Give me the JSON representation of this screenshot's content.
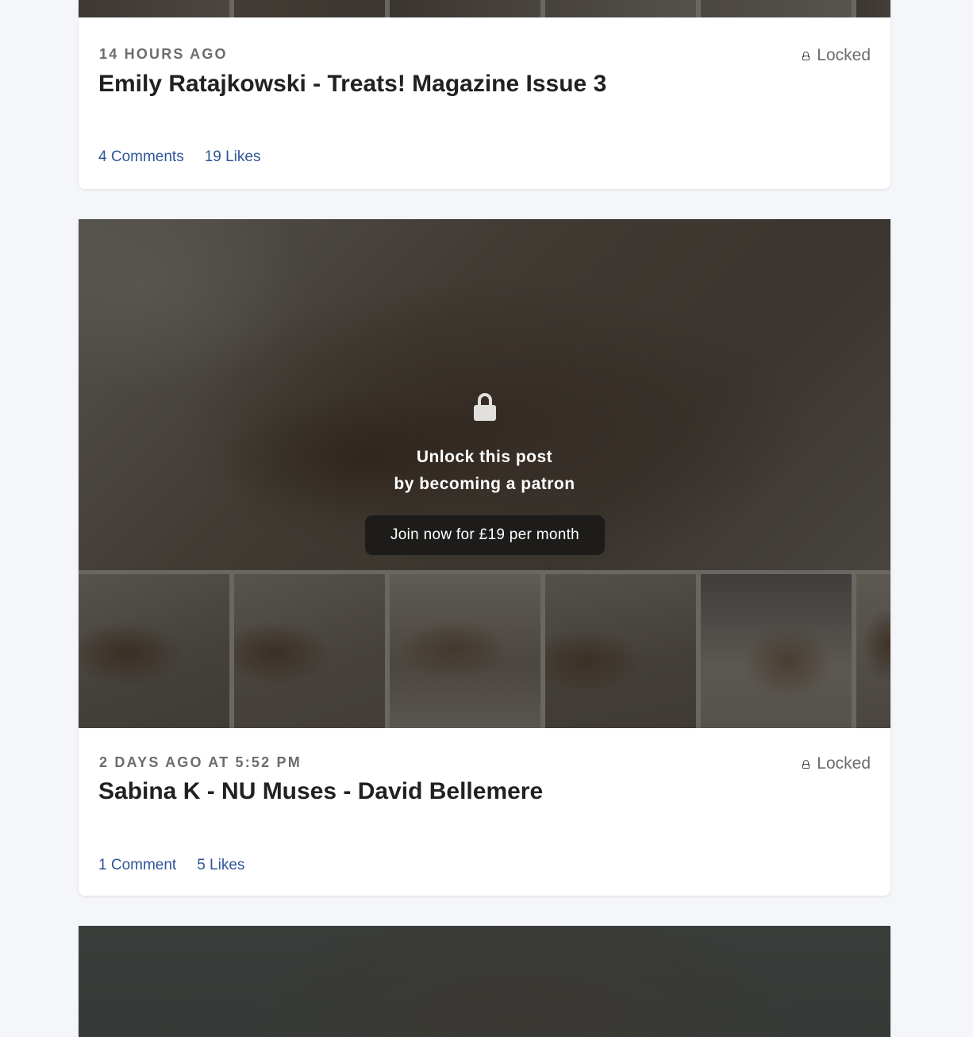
{
  "posts": [
    {
      "time": "14 HOURS AGO",
      "title": "Emily Ratajkowski - Treats! Magazine Issue 3",
      "locked_label": "Locked",
      "comments": "4 Comments",
      "likes": "19 Likes"
    },
    {
      "time": "2 DAYS AGO AT 5:52 PM",
      "title": "Sabina K - NU Muses - David Bellemere",
      "locked_label": "Locked",
      "comments": "1 Comment",
      "likes": "5 Likes",
      "unlock_line1": "Unlock this post",
      "unlock_line2": "by becoming a patron",
      "join_button": "Join now for £19 per month"
    }
  ],
  "icons": {
    "lock": "lock-icon",
    "lock_small": "lock-small-icon"
  },
  "colors": {
    "background": "#f5f6fa",
    "link": "#2e5597",
    "meta": "#6e6c69",
    "button_bg": "#1d1c1a"
  }
}
